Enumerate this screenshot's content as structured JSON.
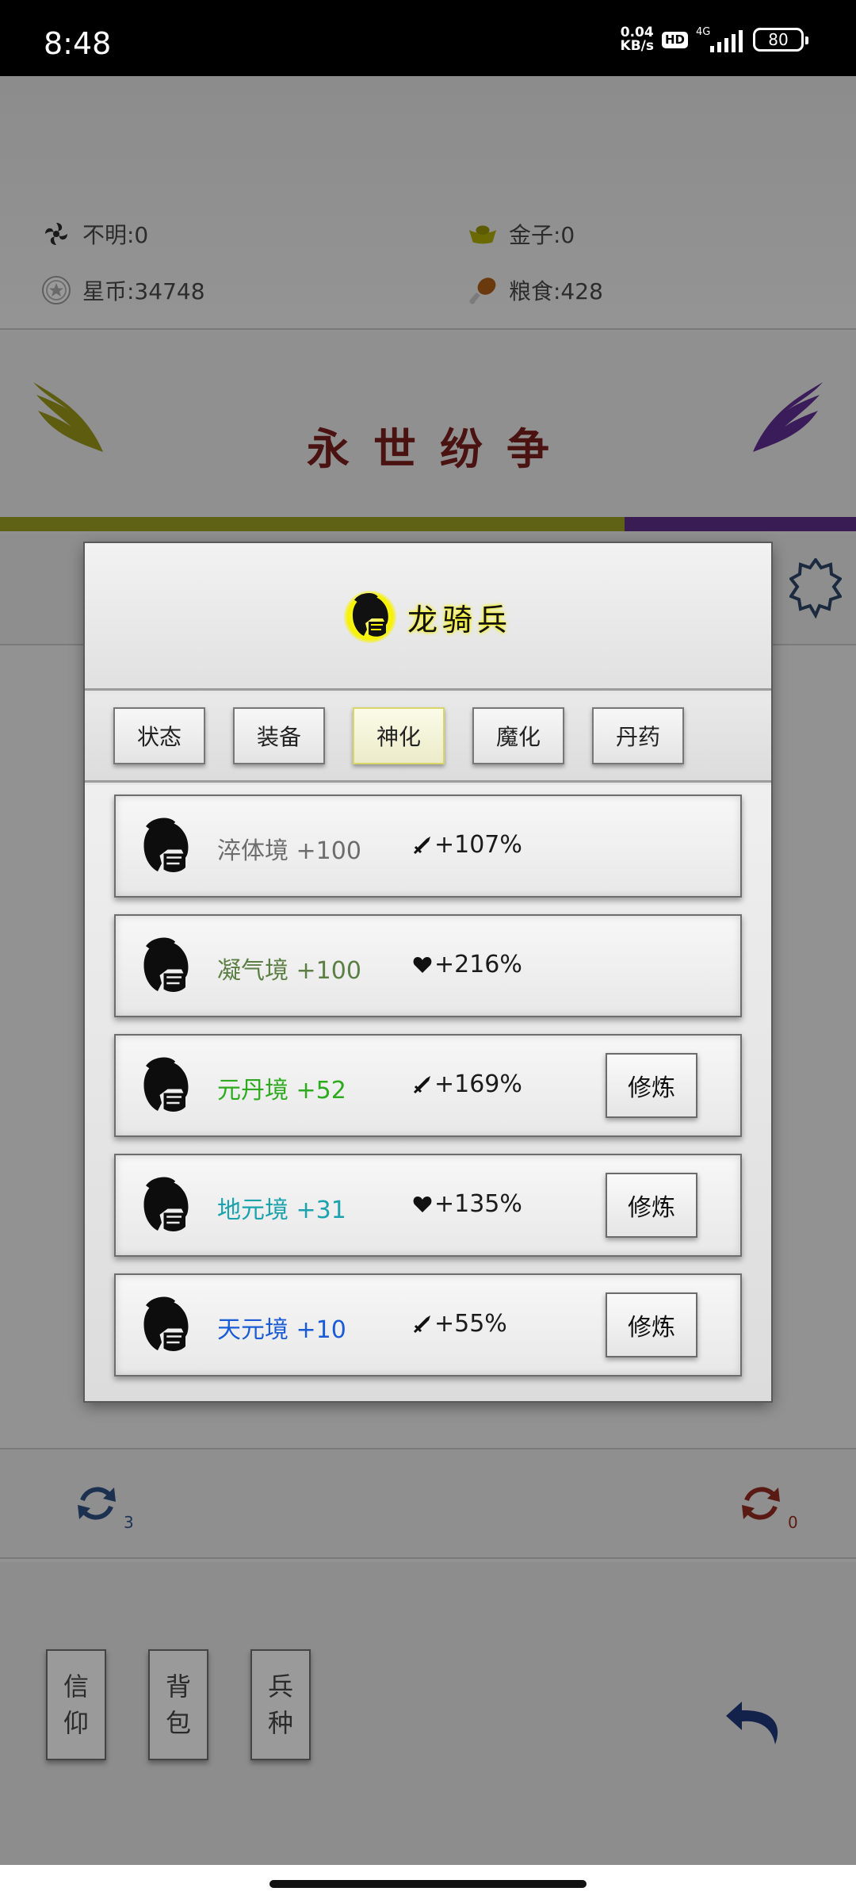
{
  "status_bar": {
    "time": "8:48",
    "speed_value": "0.04",
    "speed_unit": "KB/s",
    "hd": "HD",
    "network": "4G",
    "battery": "80"
  },
  "resources": {
    "unknown": "不明:0",
    "gold": "金子:0",
    "star_coin": "星币:34748",
    "food": "粮食:428"
  },
  "game_title": "永世纷争",
  "progress": {
    "value": 0.73
  },
  "refresh": {
    "left_count": "3",
    "right_count": "0"
  },
  "bottom_buttons": [
    {
      "line1": "信",
      "line2": "仰"
    },
    {
      "line1": "背",
      "line2": "包"
    },
    {
      "line1": "兵",
      "line2": "种"
    }
  ],
  "modal": {
    "title": "龙骑兵",
    "tabs": [
      {
        "label": "状态",
        "active": false
      },
      {
        "label": "装备",
        "active": false
      },
      {
        "label": "神化",
        "active": true
      },
      {
        "label": "魔化",
        "active": false
      },
      {
        "label": "丹药",
        "active": false
      }
    ],
    "items": [
      {
        "name": "淬体境 +100",
        "name_color": "#6d6d6d",
        "stat_icon": "sword-icon",
        "stat": "+107%",
        "button": ""
      },
      {
        "name": "凝气境 +100",
        "name_color": "#5b7f44",
        "stat_icon": "heart-icon",
        "stat": "+216%",
        "button": ""
      },
      {
        "name": "元丹境 +52",
        "name_color": "#2eaa1e",
        "stat_icon": "sword-icon",
        "stat": "+169%",
        "button": "修炼"
      },
      {
        "name": "地元境 +31",
        "name_color": "#1aa3ad",
        "stat_icon": "heart-icon",
        "stat": "+135%",
        "button": "修炼"
      },
      {
        "name": "天元境 +10",
        "name_color": "#1a5cd6",
        "stat_icon": "sword-icon",
        "stat": "+55%",
        "button": "修炼"
      }
    ]
  }
}
